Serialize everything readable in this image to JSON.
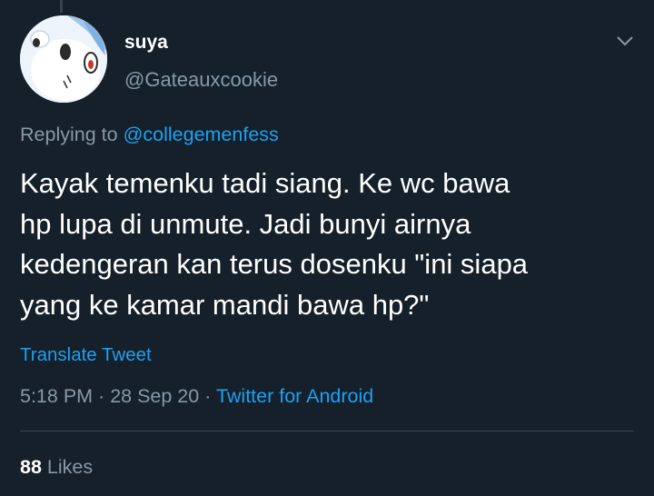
{
  "tweet": {
    "author": {
      "display_name": "suya",
      "handle": "@Gateauxcookie",
      "avatar_icon": "anime-avatar-icon"
    },
    "menu_icon": "chevron-down-icon",
    "reply_context": {
      "prefix": "Replying to",
      "mention": "@collegemenfess"
    },
    "text": "Kayak temenku tadi siang. Ke wc bawa\nhp lupa di unmute. Jadi bunyi airnya\nkedengeran kan terus dosenku \"ini siapa\nyang ke kamar mandi bawa hp?\"",
    "translate_label": "Translate Tweet",
    "meta": {
      "time": "5:18 PM",
      "separator": " · ",
      "date": "28 Sep 20",
      "source": "Twitter for Android"
    },
    "stats": {
      "likes_count": "88",
      "likes_label": "Likes"
    }
  },
  "colors": {
    "background": "#15202b",
    "primary_text": "#ffffff",
    "secondary_text": "#8899a6",
    "accent": "#1da1f2",
    "divider": "#38444d"
  }
}
